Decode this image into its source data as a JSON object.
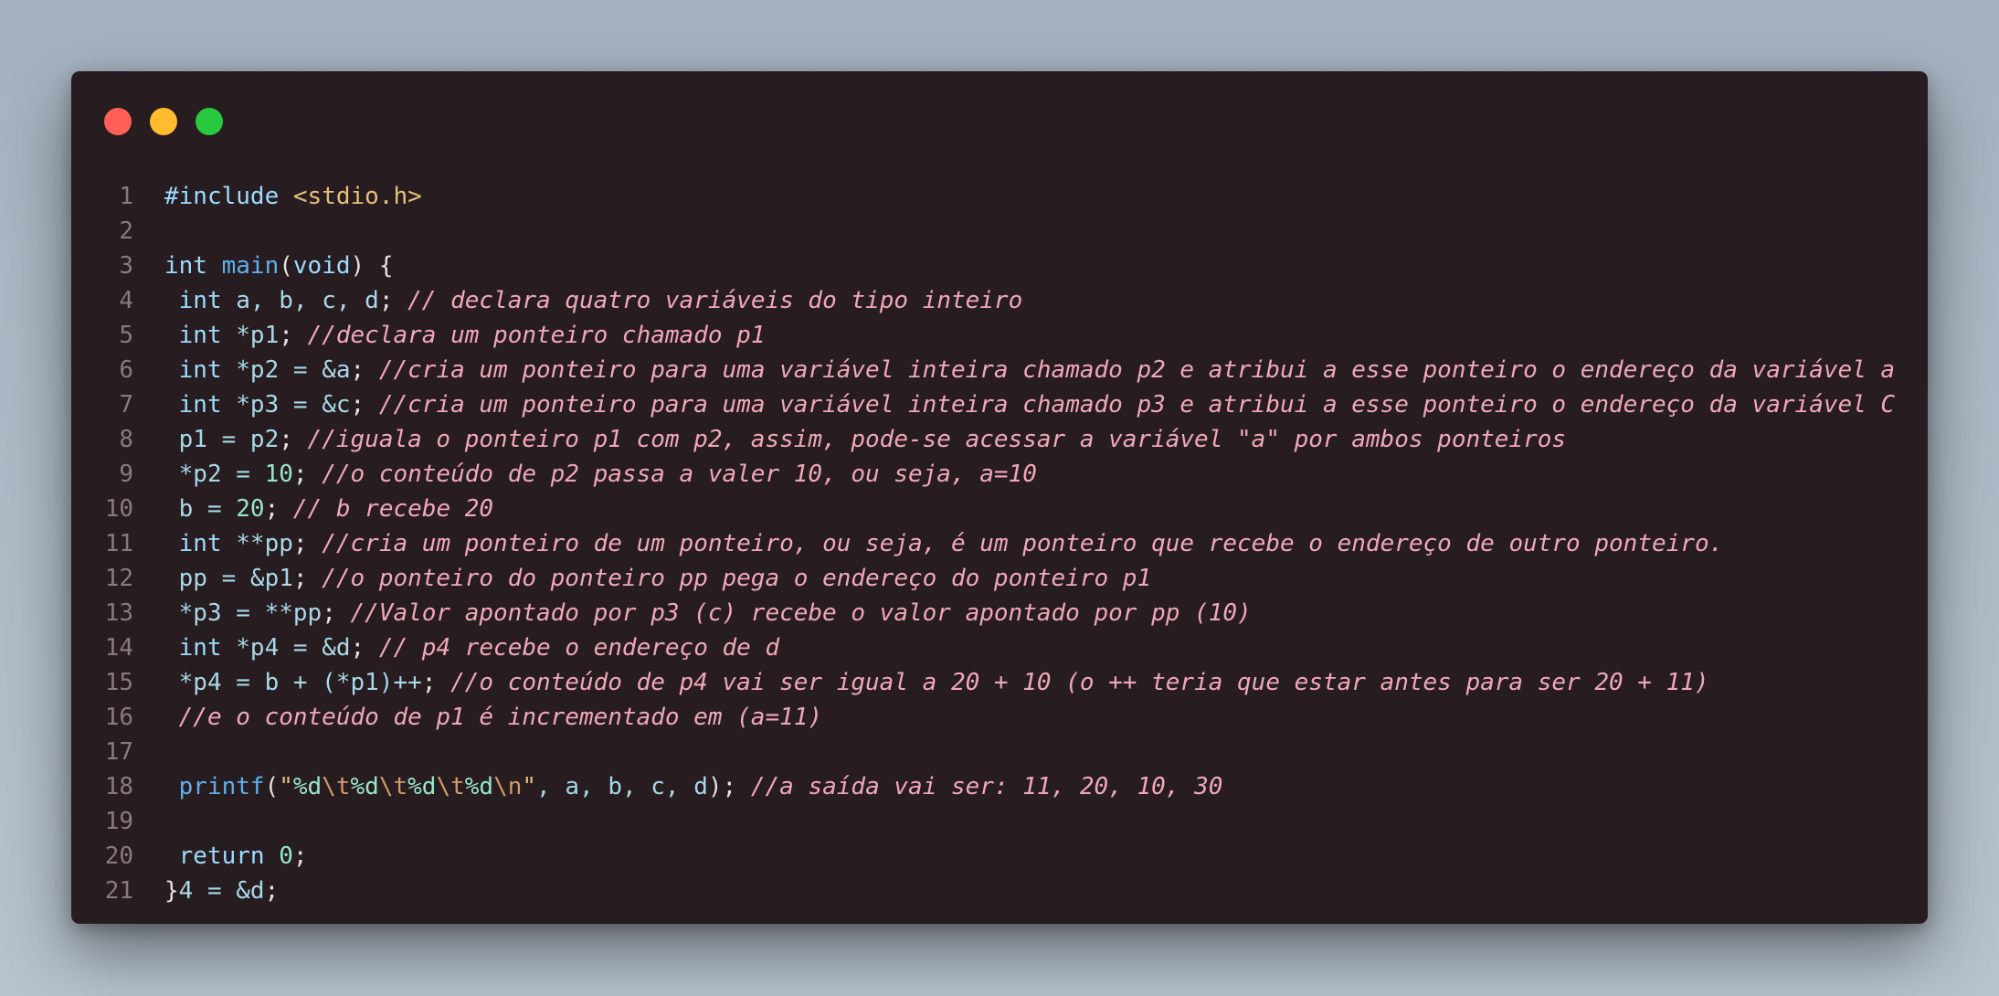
{
  "window": {
    "buttons": [
      "close",
      "minimize",
      "maximize"
    ]
  },
  "code": {
    "lines": [
      {
        "n": "1",
        "parts": [
          {
            "t": "#include ",
            "c": "k"
          },
          {
            "t": "<stdio.h>",
            "c": "s"
          }
        ]
      },
      {
        "n": "2",
        "parts": []
      },
      {
        "n": "3",
        "parts": [
          {
            "t": "int ",
            "c": "k"
          },
          {
            "t": "main",
            "c": "f"
          },
          {
            "t": "(",
            "c": "p"
          },
          {
            "t": "void",
            "c": "k"
          },
          {
            "t": ") {",
            "c": "p"
          }
        ]
      },
      {
        "n": "4",
        "parts": [
          {
            "t": " int ",
            "c": "k"
          },
          {
            "t": "a, b, c, d",
            "c": "v"
          },
          {
            "t": "; ",
            "c": "p"
          },
          {
            "t": "// declara quatro variáveis do tipo inteiro",
            "c": "c"
          }
        ]
      },
      {
        "n": "5",
        "parts": [
          {
            "t": " int ",
            "c": "k"
          },
          {
            "t": "*p1",
            "c": "v"
          },
          {
            "t": "; ",
            "c": "p"
          },
          {
            "t": "//declara um ponteiro chamado p1",
            "c": "c"
          }
        ]
      },
      {
        "n": "6",
        "parts": [
          {
            "t": " int ",
            "c": "k"
          },
          {
            "t": "*p2 = &a",
            "c": "v"
          },
          {
            "t": "; ",
            "c": "p"
          },
          {
            "t": "//cria um ponteiro para uma variável inteira chamado p2 e atribui a esse ponteiro o endereço da variável a",
            "c": "c"
          }
        ]
      },
      {
        "n": "7",
        "parts": [
          {
            "t": " int ",
            "c": "k"
          },
          {
            "t": "*p3 = &c",
            "c": "v"
          },
          {
            "t": "; ",
            "c": "p"
          },
          {
            "t": "//cria um ponteiro para uma variável inteira chamado p3 e atribui a esse ponteiro o endereço da variável C",
            "c": "c"
          }
        ]
      },
      {
        "n": "8",
        "parts": [
          {
            "t": " p1 = p2",
            "c": "v"
          },
          {
            "t": "; ",
            "c": "p"
          },
          {
            "t": "//iguala o ponteiro p1 com p2, assim, pode-se acessar a variável \"a\" por ambos ponteiros",
            "c": "c"
          }
        ]
      },
      {
        "n": "9",
        "parts": [
          {
            "t": " *p2 = ",
            "c": "v"
          },
          {
            "t": "10",
            "c": "n"
          },
          {
            "t": "; ",
            "c": "p"
          },
          {
            "t": "//o conteúdo de p2 passa a valer 10, ou seja, a=10",
            "c": "c"
          }
        ]
      },
      {
        "n": "10",
        "parts": [
          {
            "t": " b = ",
            "c": "v"
          },
          {
            "t": "20",
            "c": "n"
          },
          {
            "t": "; ",
            "c": "p"
          },
          {
            "t": "// b recebe 20",
            "c": "c"
          }
        ]
      },
      {
        "n": "11",
        "parts": [
          {
            "t": " int ",
            "c": "k"
          },
          {
            "t": "**pp",
            "c": "v"
          },
          {
            "t": "; ",
            "c": "p"
          },
          {
            "t": "//cria um ponteiro de um ponteiro, ou seja, é um ponteiro que recebe o endereço de outro ponteiro.",
            "c": "c"
          }
        ]
      },
      {
        "n": "12",
        "parts": [
          {
            "t": " pp = &p1",
            "c": "v"
          },
          {
            "t": "; ",
            "c": "p"
          },
          {
            "t": "//o ponteiro do ponteiro pp pega o endereço do ponteiro p1",
            "c": "c"
          }
        ]
      },
      {
        "n": "13",
        "parts": [
          {
            "t": " *p3 = **pp",
            "c": "v"
          },
          {
            "t": "; ",
            "c": "p"
          },
          {
            "t": "//Valor apontado por p3 (c) recebe o valor apontado por pp (10)",
            "c": "c"
          }
        ]
      },
      {
        "n": "14",
        "parts": [
          {
            "t": " int ",
            "c": "k"
          },
          {
            "t": "*p4 = &d",
            "c": "v"
          },
          {
            "t": "; ",
            "c": "p"
          },
          {
            "t": "// p4 recebe o endereço de d",
            "c": "c"
          }
        ]
      },
      {
        "n": "15",
        "parts": [
          {
            "t": " *p4 = b + (*p1)++",
            "c": "v"
          },
          {
            "t": "; ",
            "c": "p"
          },
          {
            "t": "//o conteúdo de p4 vai ser igual a 20 + 10 (o ++ teria que estar antes para ser 20 + 11)",
            "c": "c"
          }
        ]
      },
      {
        "n": "16",
        "parts": [
          {
            "t": " //e o conteúdo de p1 é incrementado em (a=11)",
            "c": "c"
          }
        ]
      },
      {
        "n": "17",
        "parts": []
      },
      {
        "n": "18",
        "parts": [
          {
            "t": " printf",
            "c": "f"
          },
          {
            "t": "(",
            "c": "p"
          },
          {
            "t": "\"",
            "c": "str"
          },
          {
            "t": "%d",
            "c": "n"
          },
          {
            "t": "\\t",
            "c": "esc"
          },
          {
            "t": "%d",
            "c": "n"
          },
          {
            "t": "\\t",
            "c": "esc"
          },
          {
            "t": "%d",
            "c": "n"
          },
          {
            "t": "\\t",
            "c": "esc"
          },
          {
            "t": "%d",
            "c": "n"
          },
          {
            "t": "\\n",
            "c": "esc"
          },
          {
            "t": "\"",
            "c": "str"
          },
          {
            "t": ", a, b, c, d",
            "c": "v"
          },
          {
            "t": "); ",
            "c": "p"
          },
          {
            "t": "//a saída vai ser: 11, 20, 10, 30",
            "c": "c"
          }
        ]
      },
      {
        "n": "19",
        "parts": []
      },
      {
        "n": "20",
        "parts": [
          {
            "t": " return ",
            "c": "k"
          },
          {
            "t": "0",
            "c": "n"
          },
          {
            "t": ";",
            "c": "p"
          }
        ]
      },
      {
        "n": "21",
        "parts": [
          {
            "t": "}",
            "c": "p"
          },
          {
            "t": "4 = &d",
            "c": "v"
          },
          {
            "t": ";",
            "c": "p"
          }
        ]
      }
    ]
  }
}
